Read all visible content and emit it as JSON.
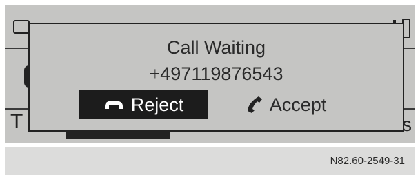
{
  "dialog": {
    "title": "Call Waiting",
    "caller_number": "+497119876543",
    "reject_label": "Reject",
    "accept_label": "Accept",
    "reject_icon": "hang-up-icon",
    "accept_icon": "phone-handset-icon"
  },
  "background": {
    "bottom_left_text": "T",
    "bottom_right_text": "s"
  },
  "figure_id": "N82.60-2549-31",
  "colors": {
    "screen": "#c5c5c3",
    "selected_button": "#1c1c1c",
    "text": "#2a2a2a"
  }
}
